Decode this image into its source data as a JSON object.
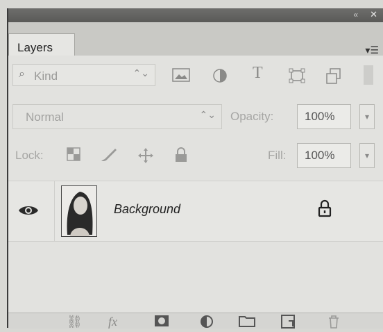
{
  "panel": {
    "tab_label": "Layers",
    "collapse_icon": "«",
    "close_icon": "✕",
    "menu_icon": "▾☰"
  },
  "filter": {
    "kind_label": "Kind",
    "kind_icon": "search-icon",
    "icons": [
      "image-filter-icon",
      "adjustment-filter-icon",
      "type-filter-icon",
      "shape-filter-icon",
      "smart-object-filter-icon"
    ]
  },
  "blend": {
    "mode": "Normal",
    "opacity_label": "Opacity:",
    "opacity_value": "100%"
  },
  "locks": {
    "lock_label": "Lock:",
    "fill_label": "Fill:",
    "fill_value": "100%"
  },
  "layers": [
    {
      "name": "Background",
      "visible": true,
      "locked": true
    }
  ],
  "bottom_icons": [
    "link-layers-icon",
    "fx-icon",
    "mask-icon",
    "adjustment-layer-icon",
    "group-folder-icon",
    "new-layer-icon",
    "trash-icon"
  ]
}
